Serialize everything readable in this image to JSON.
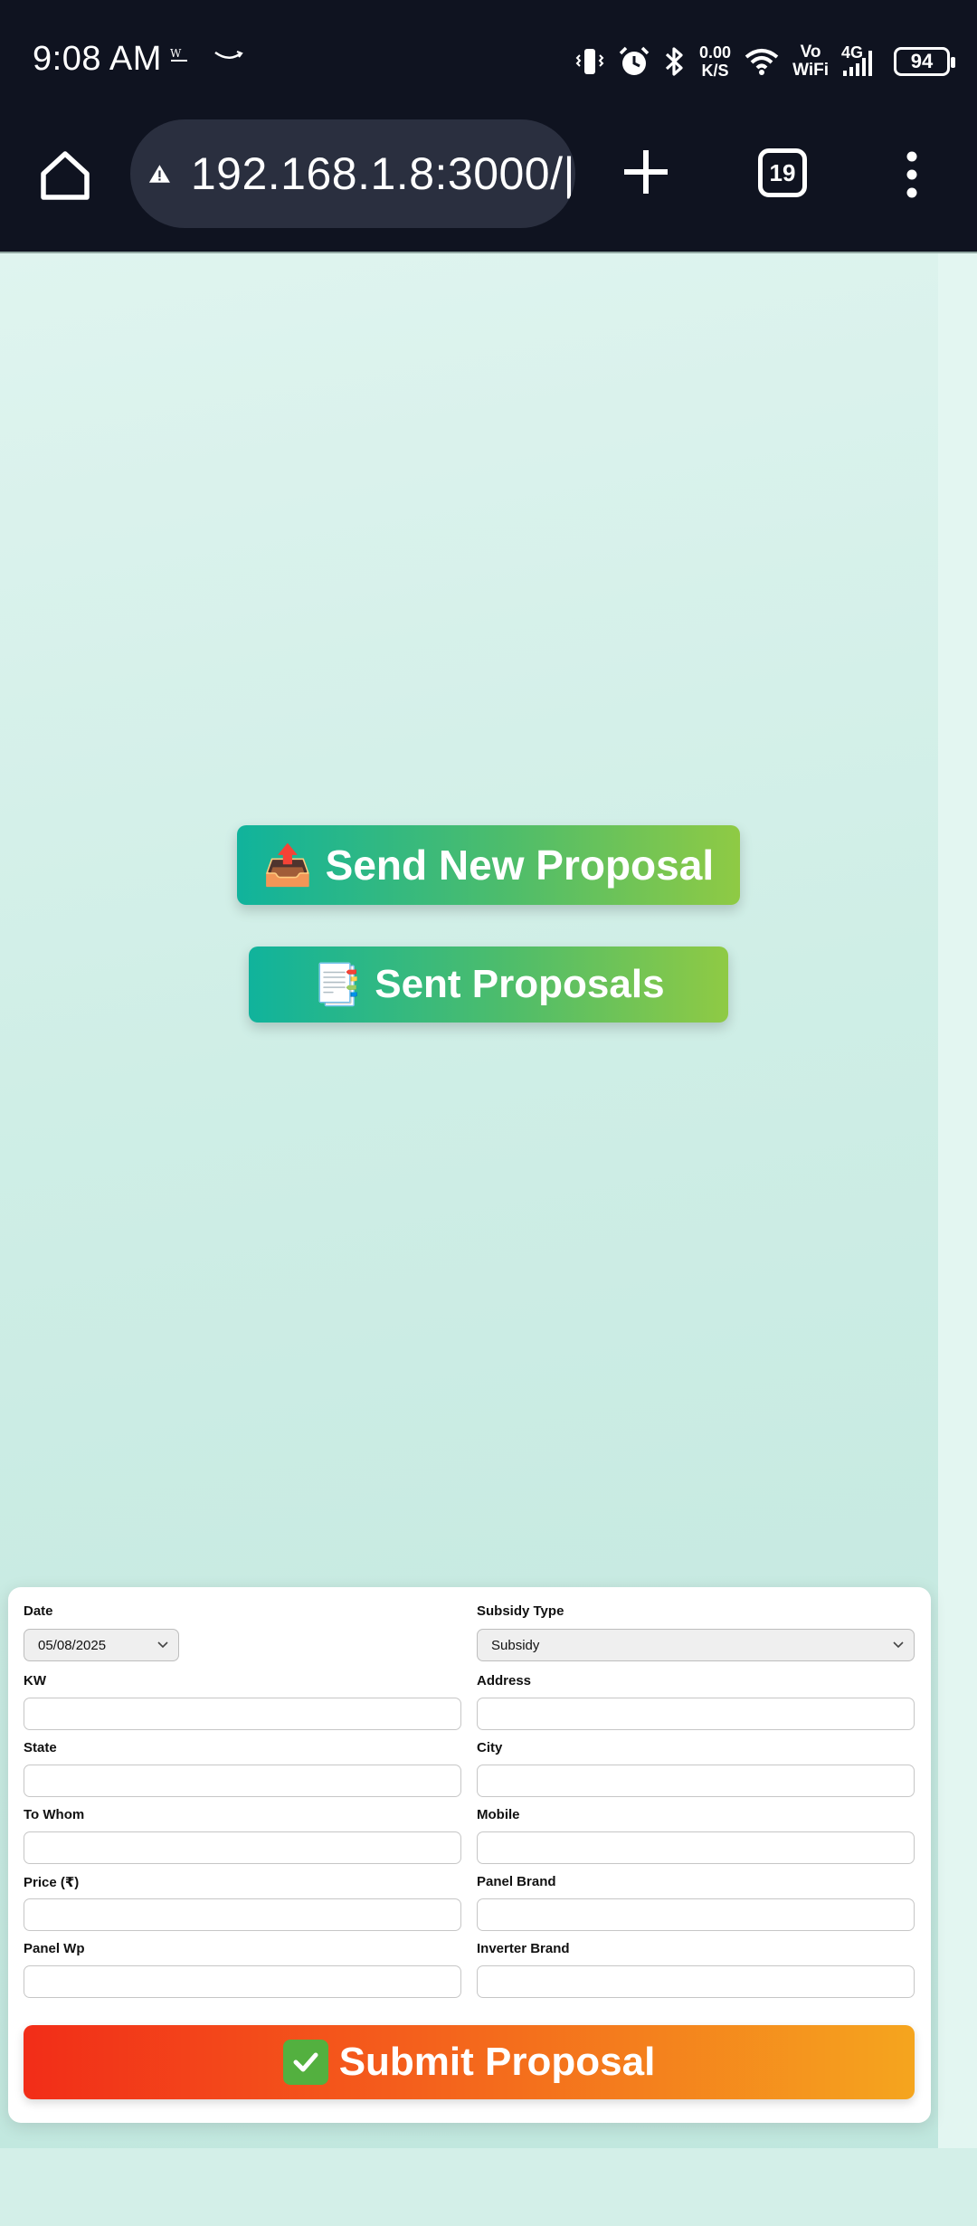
{
  "status_bar": {
    "time": "9:08 AM",
    "net_speed_value": "0.00",
    "net_speed_unit": "K/S",
    "vo": "Vo",
    "wifi": "WiFi",
    "network": "4G",
    "battery": "94",
    "icons": [
      "wo-logo-icon",
      "amazon-smile-icon",
      "vibrate-icon",
      "alarm-icon",
      "bluetooth-icon",
      "wifi-icon",
      "signal-icon",
      "battery-icon"
    ]
  },
  "browser": {
    "url": "192.168.1.8:3000/|",
    "tab_count": "19",
    "icons": [
      "home-icon",
      "warning-icon",
      "plus-icon",
      "menu-icon"
    ]
  },
  "main": {
    "send_new_label": "Send New Proposal",
    "send_new_emoji": "📤",
    "sent_label": "Sent Proposals",
    "sent_emoji": "📑"
  },
  "form": {
    "date_label": "Date",
    "date_value": "05/08/2025",
    "subsidy_label": "Subsidy Type",
    "subsidy_value": "Subsidy",
    "kw_label": "KW",
    "address_label": "Address",
    "state_label": "State",
    "city_label": "City",
    "to_whom_label": "To Whom",
    "mobile_label": "Mobile",
    "price_label": "Price (₹)",
    "panel_brand_label": "Panel Brand",
    "panel_wp_label": "Panel Wp",
    "inverter_brand_label": "Inverter Brand",
    "submit_label": "Submit Proposal"
  },
  "colors": {
    "status_bg": "#0f1320",
    "url_pill_bg": "#2a2f3f",
    "green_gradient_start": "#10b39c",
    "green_gradient_end": "#8fca44",
    "submit_gradient_start": "#f22d18",
    "submit_gradient_end": "#f5a51e"
  }
}
